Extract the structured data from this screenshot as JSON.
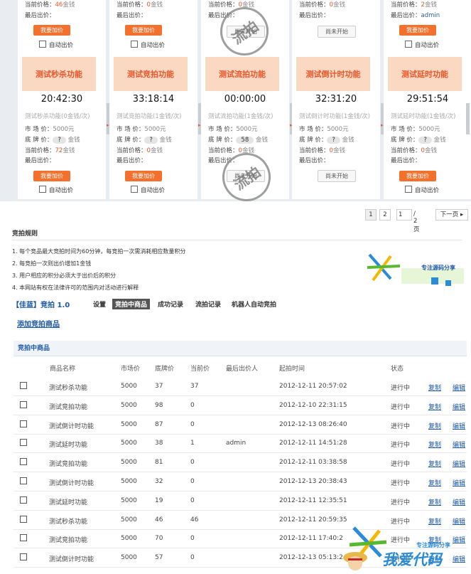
{
  "top_row": [
    {
      "current_price": "46",
      "last_bidder": "",
      "action": "bid"
    },
    {
      "current_price": "0",
      "last_bidder": "",
      "action": "bid"
    },
    {
      "current_price": "0",
      "last_bidder": "",
      "action": "wait"
    },
    {
      "current_price": "0",
      "last_bidder": "",
      "action": "wait"
    },
    {
      "current_price": "2",
      "last_bidder": "admin",
      "action": "bid"
    }
  ],
  "cards": [
    {
      "banner": "测试秒杀功能",
      "timer": "20:42:30",
      "subtitle": "测试秒杀功能(0金钱/次)",
      "market": "5000元",
      "reserve": "?",
      "current": "72",
      "last": "",
      "action": "bid"
    },
    {
      "banner": "测试竞拍功能",
      "timer": "33:18:14",
      "subtitle": "测试竞拍功能(1金钱/次)",
      "market": "5000元",
      "reserve": "?",
      "current": "0",
      "last": "",
      "action": "bid"
    },
    {
      "banner": "测试流拍功能",
      "timer": "00:00:00",
      "subtitle": "测试流拍功能(1金钱/次)",
      "market": "5000元",
      "reserve": "58",
      "current": "0",
      "last": "",
      "action": "wait"
    },
    {
      "banner": "测试倒计时功能",
      "timer": "32:31:20",
      "subtitle": "测试倒计时功能(1金钱/次)",
      "market": "5000元",
      "reserve": "?",
      "current": "0",
      "last": "",
      "action": "wait"
    },
    {
      "banner": "测试延时功能",
      "timer": "29:51:54",
      "subtitle": "测试延时功能(1金钱/次)",
      "market": "5000元",
      "reserve": "?",
      "current": "0",
      "last": "",
      "action": "bid"
    }
  ],
  "labels": {
    "market": "市 场 价：",
    "reserve": "底 牌 价：",
    "current": "当前价格：",
    "last": "最后出价：",
    "unit": "金钱",
    "bid_button": "我要加价",
    "wait_button": "尚未开始",
    "auto_bid": "自动出价",
    "stamp": "流拍"
  },
  "pager": {
    "page1": "1",
    "page2": "2",
    "input": "1",
    "total": "/ 2 页",
    "next": "下一页"
  },
  "rules": {
    "title": "竞拍规则",
    "items": [
      "1. 每个竞品最大竞拍时间为60分钟，每竞拍一次需消耗相应数量积分",
      "2. 每竞拍一次则出价增加1金钱",
      "3. 用户相应的积分必须大于出价后的积分",
      "4. 本网站有权在法律许可的范围内对活动进行解释"
    ]
  },
  "watermark1": "专注源码分享",
  "header": {
    "brand": "【佳蓝】竞拍 1.0",
    "tabs": [
      "设置",
      "竞拍中商品",
      "成功记录",
      "流拍记录",
      "机器人自动竞拍"
    ]
  },
  "add_link": "添加竞拍商品",
  "section_title": "竞拍中商品",
  "table": {
    "headers": [
      "商品名称",
      "市场价",
      "底牌价",
      "当前价",
      "最后出价人",
      "起拍时间",
      "状态"
    ],
    "copy": "复制",
    "edit": "编辑",
    "rows": [
      {
        "name": "测试秒杀功能",
        "market": "5000",
        "reserve": "37",
        "current": "37",
        "last": "",
        "start": "2012-12-11 20:57:02",
        "status": "进行中"
      },
      {
        "name": "测试竞拍功能",
        "market": "5000",
        "reserve": "98",
        "current": "0",
        "last": "",
        "start": "2012-12-10 22:31:15",
        "status": "进行中"
      },
      {
        "name": "测试倒计时功能",
        "market": "5000",
        "reserve": "87",
        "current": "0",
        "last": "",
        "start": "2012-12-13 08:26:40",
        "status": "进行中"
      },
      {
        "name": "测试延时功能",
        "market": "5000",
        "reserve": "38",
        "current": "1",
        "last": "admin",
        "start": "2012-12-11 14:51:28",
        "status": "进行中"
      },
      {
        "name": "测试竞拍功能",
        "market": "5000",
        "reserve": "81",
        "current": "0",
        "last": "",
        "start": "2012-12-11 03:38:58",
        "status": "进行中"
      },
      {
        "name": "测试倒计时功能",
        "market": "5000",
        "reserve": "32",
        "current": "0",
        "last": "",
        "start": "2012-12-13 20:38:43",
        "status": "进行中"
      },
      {
        "name": "测试延时功能",
        "market": "5000",
        "reserve": "19",
        "current": "0",
        "last": "",
        "start": "2012-12-11 12:35:51",
        "status": "进行中"
      },
      {
        "name": "测试秒杀功能",
        "market": "5000",
        "reserve": "46",
        "current": "46",
        "last": "",
        "start": "2012-12-11 20:59:35",
        "status": "进行中"
      },
      {
        "name": "测试竞拍功能",
        "market": "5000",
        "reserve": "70",
        "current": "0",
        "last": "",
        "start": "2012-12-11 17:40:2",
        "status": "进行中"
      },
      {
        "name": "测试倒计时功能",
        "market": "5000",
        "reserve": "57",
        "current": "0",
        "last": "",
        "start": "2012-12-13 05:13:2",
        "status": "进行中"
      }
    ]
  },
  "watermark2": {
    "top": "专注源码分享",
    "main": "我爱代码"
  },
  "colors": {
    "accent": "#f3712d",
    "banner": "#fbd8c2",
    "link": "#1a57a6",
    "bg": "#e9edf1"
  }
}
